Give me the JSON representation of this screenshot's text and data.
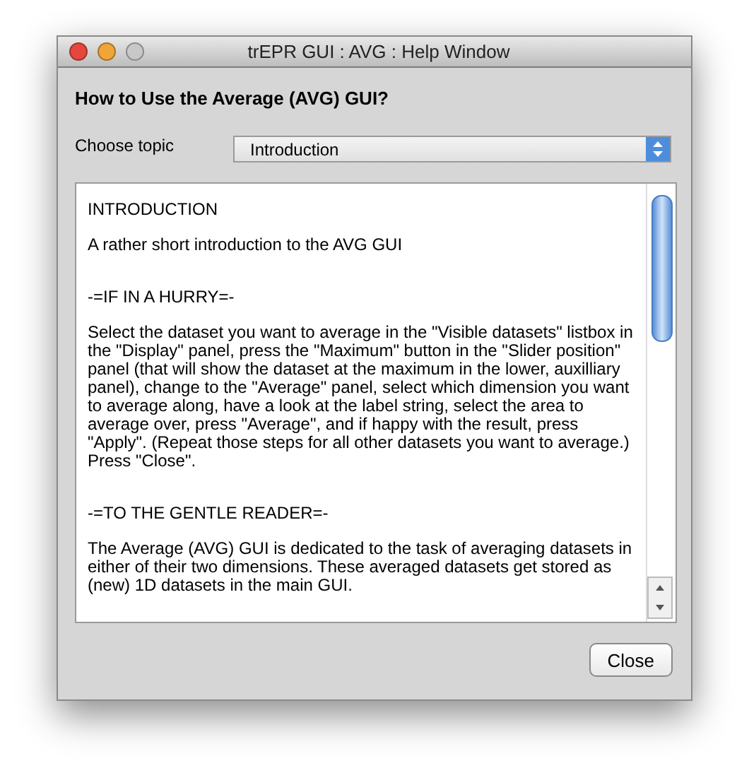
{
  "window": {
    "title": "trEPR GUI : AVG : Help Window"
  },
  "heading": "How to Use the Average (AVG) GUI?",
  "topic": {
    "label": "Choose topic",
    "value": "Introduction"
  },
  "help_text": [
    {
      "kind": "title",
      "text": "INTRODUCTION"
    },
    {
      "kind": "text",
      "text": "A rather short introduction to the AVG GUI"
    },
    {
      "kind": "section",
      "text": "-=IF IN A HURRY=-"
    },
    {
      "kind": "text",
      "text": "Select the dataset you want to average in the \"Visible datasets\" listbox in the \"Display\" panel, press the \"Maximum\" button in the \"Slider position\" panel (that will show the dataset at the maximum in the lower, auxilliary panel), change to the \"Average\" panel, select which dimension you want to average along, have a look at the label string, select the area to average over, press \"Average\", and if happy with the result, press \"Apply\". (Repeat those steps for all other datasets you want to average.) Press \"Close\"."
    },
    {
      "kind": "section",
      "text": "-=TO THE GENTLE READER=-"
    },
    {
      "kind": "text",
      "text": "The Average (AVG) GUI is dedicated to the task of averaging datasets in either of their two dimensions. These averaged datasets get stored as (new) 1D datasets in the main GUI."
    }
  ],
  "buttons": [
    "Close"
  ]
}
